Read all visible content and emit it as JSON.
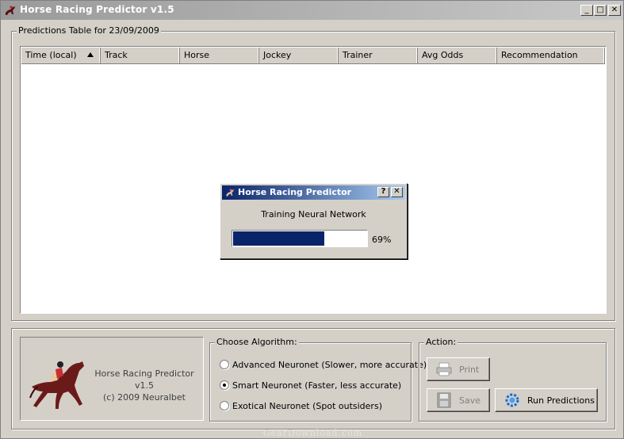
{
  "window": {
    "title": "Horse Racing Predictor v1.5",
    "minimize": "_",
    "maximize": "□",
    "close": "✕"
  },
  "predictions": {
    "group_title": "Predictions Table for 23/09/2009",
    "columns": [
      "Time (local)",
      "Track",
      "Horse",
      "Jockey",
      "Trainer",
      "Avg Odds",
      "Recommendation"
    ],
    "rows": []
  },
  "dialog": {
    "title": "Horse Racing Predictor",
    "help": "?",
    "close": "✕",
    "message": "Training Neural Network",
    "progress_percent": 69,
    "progress_label": "69%"
  },
  "logo": {
    "line1": "Horse Racing Predictor v1.5",
    "line2": "(c) 2009 Neuralbet"
  },
  "algorithm": {
    "group_title": "Choose Algorithm:",
    "options": [
      {
        "label": "Advanced Neuronet (Slower, more accurate)",
        "selected": false
      },
      {
        "label": "Smart Neuronet (Faster, less accurate)",
        "selected": true
      },
      {
        "label": "Exotical Neuronet (Spot outsiders)",
        "selected": false
      }
    ]
  },
  "action": {
    "group_title": "Action:",
    "print_label": "Print",
    "save_label": "Save",
    "run_label": "Run Predictions"
  },
  "watermark": "GearDownload.com",
  "colors": {
    "progress_fill": "#0a246a",
    "dialog_title": "#0a246a",
    "window_face": "#d4d0c8"
  }
}
